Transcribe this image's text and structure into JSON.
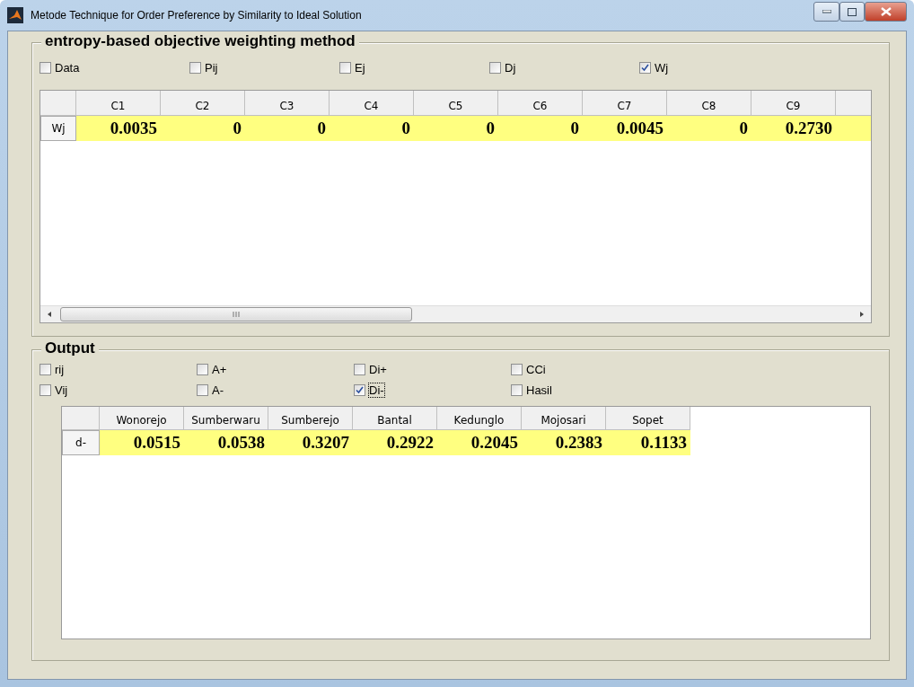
{
  "window": {
    "title": "Metode Technique for Order Preference by Similarity to Ideal Solution"
  },
  "entropy_panel": {
    "title": "entropy-based objective weighting method",
    "checkboxes": [
      {
        "label": "Data",
        "checked": false
      },
      {
        "label": "Pij",
        "checked": false
      },
      {
        "label": "Ej",
        "checked": false
      },
      {
        "label": "Dj",
        "checked": false
      },
      {
        "label": "Wj",
        "checked": true
      }
    ],
    "table": {
      "columns": [
        "C1",
        "C2",
        "C3",
        "C4",
        "C5",
        "C6",
        "C7",
        "C8",
        "C9"
      ],
      "rows": [
        {
          "header": "Wj",
          "cells": [
            "0.0035",
            "0",
            "0",
            "0",
            "0",
            "0",
            "0.0045",
            "0",
            "0.2730"
          ]
        }
      ]
    }
  },
  "output_panel": {
    "title": "Output",
    "checkboxes": [
      {
        "label": "rij",
        "checked": false,
        "focused": false
      },
      {
        "label": "A+",
        "checked": false,
        "focused": false
      },
      {
        "label": "Di+",
        "checked": false,
        "focused": false
      },
      {
        "label": "CCi",
        "checked": false,
        "focused": false
      },
      {
        "label": "Vij",
        "checked": false,
        "focused": false
      },
      {
        "label": "A-",
        "checked": false,
        "focused": false
      },
      {
        "label": "Di-",
        "checked": true,
        "focused": true
      },
      {
        "label": "Hasil",
        "checked": false,
        "focused": false
      }
    ],
    "table": {
      "columns": [
        "Wonorejo",
        "Sumberwaru",
        "Sumberejo",
        "Bantal",
        "Kedunglo",
        "Mojosari",
        "Sopet"
      ],
      "rows": [
        {
          "header": "d-",
          "cells": [
            "0.0515",
            "0.0538",
            "0.3207",
            "0.2922",
            "0.2045",
            "0.2383",
            "0.1133"
          ]
        }
      ]
    }
  }
}
